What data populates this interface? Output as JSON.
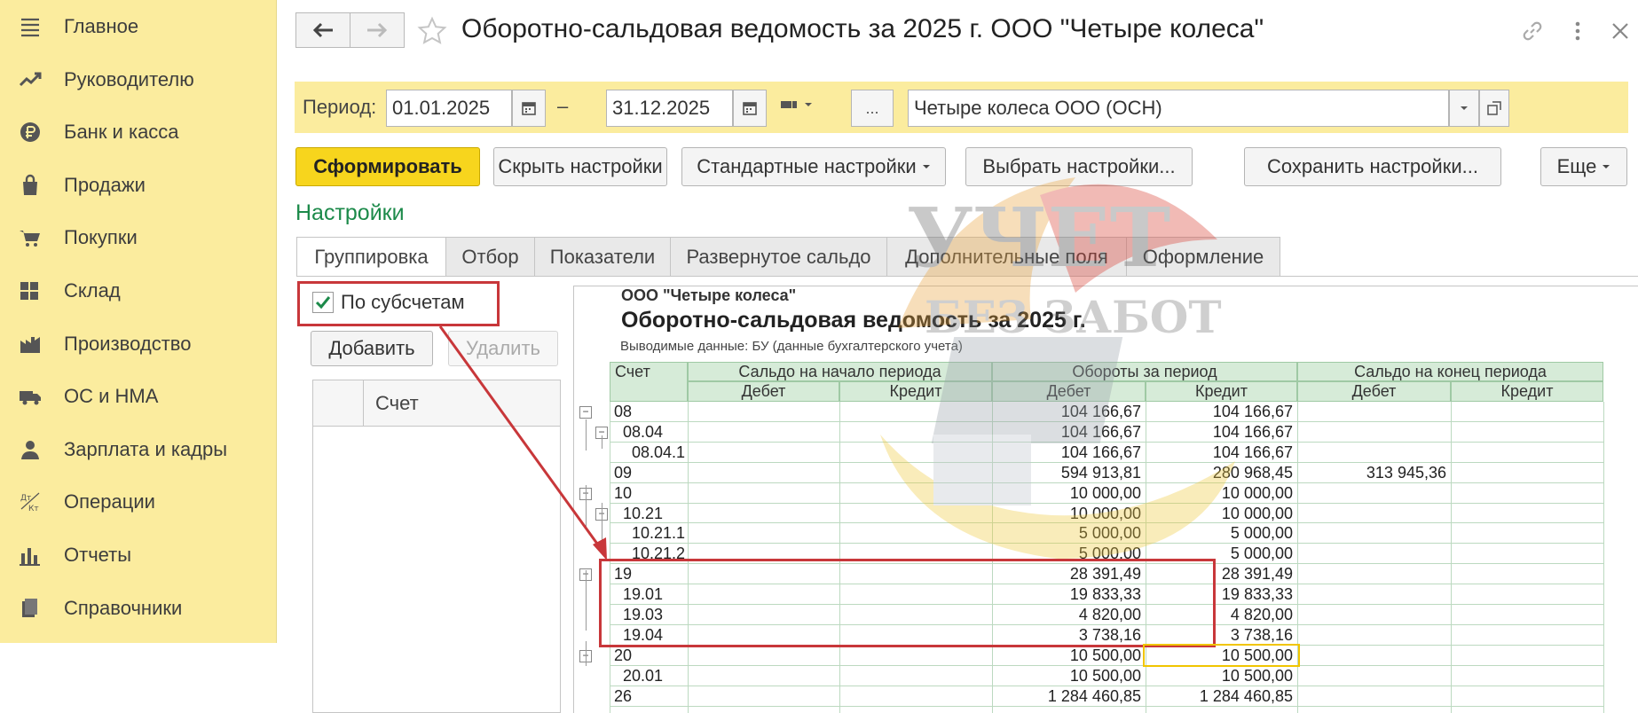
{
  "sidebar": {
    "items": [
      {
        "label": "Главное",
        "icon": "menu-lines-icon"
      },
      {
        "label": "Руководителю",
        "icon": "trend-up-icon"
      },
      {
        "label": "Банк и касса",
        "icon": "ruble-coin-icon"
      },
      {
        "label": "Продажи",
        "icon": "shopping-bag-icon"
      },
      {
        "label": "Покупки",
        "icon": "cart-icon"
      },
      {
        "label": "Склад",
        "icon": "warehouse-grid-icon"
      },
      {
        "label": "Производство",
        "icon": "factory-icon"
      },
      {
        "label": "ОС и НМА",
        "icon": "truck-icon"
      },
      {
        "label": "Зарплата и кадры",
        "icon": "person-icon"
      },
      {
        "label": "Операции",
        "icon": "dt-kt-icon"
      },
      {
        "label": "Отчеты",
        "icon": "bar-chart-icon"
      },
      {
        "label": "Справочники",
        "icon": "books-icon"
      }
    ]
  },
  "window": {
    "title": "Оборотно-сальдовая ведомость за 2025 г. ООО \"Четыре колеса\""
  },
  "period": {
    "label": "Период:",
    "start": "01.01.2025",
    "dash": "–",
    "end": "31.12.2025",
    "more": "...",
    "organization": "Четыре колеса ООО (ОСН)"
  },
  "toolbar": {
    "generate": "Сформировать",
    "hide_settings": "Скрыть настройки",
    "standard_settings": "Стандартные настройки",
    "choose_settings": "Выбрать настройки...",
    "save_settings": "Сохранить настройки...",
    "more": "Еще"
  },
  "settings": {
    "title": "Настройки",
    "tabs": [
      "Группировка",
      "Отбор",
      "Показатели",
      "Развернутое сальдо",
      "Дополнительные поля",
      "Оформление"
    ],
    "checkbox_label": "По субсчетам",
    "checkbox_checked": true,
    "add": "Добавить",
    "delete": "Удалить",
    "column": "Счет"
  },
  "report": {
    "org": "ООО \"Четыре колеса\"",
    "title": "Оборотно-сальдовая ведомость за 2025 г.",
    "output": "Выводимые данные: БУ (данные бухгалтерского учета)",
    "headers": {
      "account": "Счет",
      "opening": "Сальдо на начало периода",
      "turnover": "Обороты за период",
      "closing": "Сальдо на конец периода",
      "debit": "Дебет",
      "credit": "Кредит"
    },
    "rows": [
      {
        "account": "08",
        "od": "",
        "oc": "",
        "td": "104 166,67",
        "tc": "104 166,67",
        "cd": "",
        "cc": ""
      },
      {
        "account": "08.04",
        "od": "",
        "oc": "",
        "td": "104 166,67",
        "tc": "104 166,67",
        "cd": "",
        "cc": ""
      },
      {
        "account": "08.04.1",
        "od": "",
        "oc": "",
        "td": "104 166,67",
        "tc": "104 166,67",
        "cd": "",
        "cc": ""
      },
      {
        "account": "09",
        "od": "",
        "oc": "",
        "td": "594 913,81",
        "tc": "280 968,45",
        "cd": "313 945,36",
        "cc": ""
      },
      {
        "account": "10",
        "od": "",
        "oc": "",
        "td": "10 000,00",
        "tc": "10 000,00",
        "cd": "",
        "cc": ""
      },
      {
        "account": "10.21",
        "od": "",
        "oc": "",
        "td": "10 000,00",
        "tc": "10 000,00",
        "cd": "",
        "cc": ""
      },
      {
        "account": "10.21.1",
        "od": "",
        "oc": "",
        "td": "5 000,00",
        "tc": "5 000,00",
        "cd": "",
        "cc": ""
      },
      {
        "account": "10.21.2",
        "od": "",
        "oc": "",
        "td": "5 000,00",
        "tc": "5 000,00",
        "cd": "",
        "cc": ""
      },
      {
        "account": "19",
        "od": "",
        "oc": "",
        "td": "28 391,49",
        "tc": "28 391,49",
        "cd": "",
        "cc": ""
      },
      {
        "account": "19.01",
        "od": "",
        "oc": "",
        "td": "19 833,33",
        "tc": "19 833,33",
        "cd": "",
        "cc": ""
      },
      {
        "account": "19.03",
        "od": "",
        "oc": "",
        "td": "4 820,00",
        "tc": "4 820,00",
        "cd": "",
        "cc": ""
      },
      {
        "account": "19.04",
        "od": "",
        "oc": "",
        "td": "3 738,16",
        "tc": "3 738,16",
        "cd": "",
        "cc": ""
      },
      {
        "account": "20",
        "od": "",
        "oc": "",
        "td": "10 500,00",
        "tc": "10 500,00",
        "cd": "",
        "cc": ""
      },
      {
        "account": "20.01",
        "od": "",
        "oc": "",
        "td": "10 500,00",
        "tc": "10 500,00",
        "cd": "",
        "cc": ""
      },
      {
        "account": "26",
        "od": "",
        "oc": "",
        "td": "1 284 460,85",
        "tc": "1 284 460,85",
        "cd": "",
        "cc": ""
      }
    ]
  },
  "watermark": {
    "line1": "УЧЕТ",
    "line2": "БЕЗ ЗАБОТ"
  },
  "colors": {
    "sidebar_bg": "#fbec9e",
    "primary_button": "#f7d51d",
    "settings_title": "#1c8a4a",
    "highlight_red": "#c8373a",
    "highlight_yellow": "#f1c500",
    "table_header": "#d6ebd8"
  }
}
